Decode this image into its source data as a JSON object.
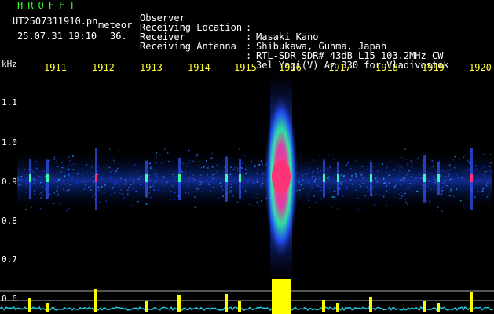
{
  "header": {
    "app_title": "HROFFT",
    "filename": "UT2507311910.pn",
    "meteor_label": "meteor",
    "timestamp": "25.07.31 19:10",
    "count": "36."
  },
  "info": [
    {
      "key": "Observer",
      "value": "Masaki Kano"
    },
    {
      "key": "Receiving Location",
      "value": "Shibukawa, Gunma, Japan"
    },
    {
      "key": "Receiver",
      "value": "RTL-SDR SDR# 43dB L15 103.2MHz CW"
    },
    {
      "key": "Receiving Antenna",
      "value": "3el Yagi(V) Az 330 for Vladivostok"
    }
  ],
  "axis": {
    "unit": "kHz",
    "y_ticks": [
      "1.1",
      "1.0",
      "0.9",
      "0.8",
      "0.7",
      "0.6"
    ],
    "x_ticks": [
      "1911",
      "1912",
      "1913",
      "1914",
      "1915",
      "1916",
      "1917",
      "1918",
      "1919",
      "1920"
    ]
  },
  "colors": {
    "text": "#ffffff",
    "axis_labels": "#ffff33",
    "title": "#33ff33",
    "meteor_core": "#ff3366",
    "signal": "#3355ff",
    "power_trace": "#ffff00",
    "noise_floor": "#22c7e0"
  }
}
